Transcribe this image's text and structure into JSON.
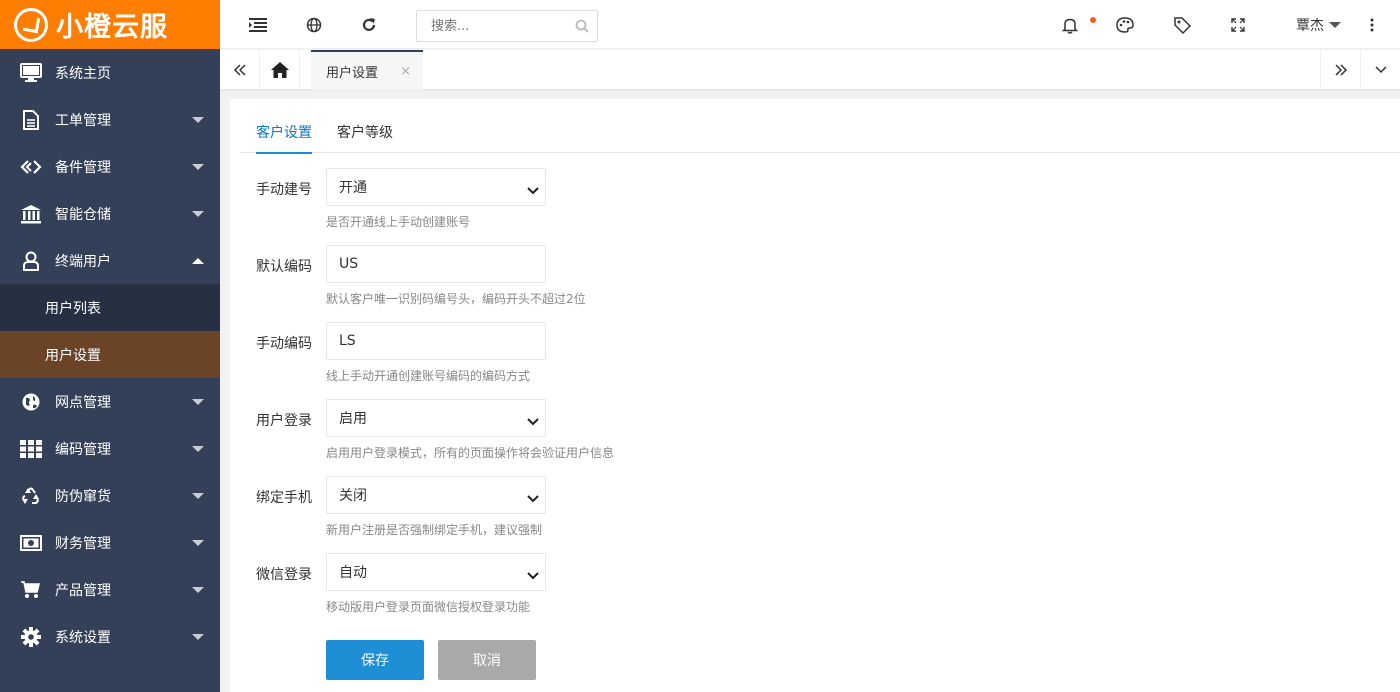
{
  "brand": {
    "name": "小橙云服",
    "color": "#ff7d00"
  },
  "sidebar": {
    "items": [
      {
        "label": "系统主页",
        "icon": "monitor-icon",
        "caret": false
      },
      {
        "label": "工单管理",
        "icon": "document-icon",
        "caret": "down"
      },
      {
        "label": "备件管理",
        "icon": "diamond-link-icon",
        "caret": "down"
      },
      {
        "label": "智能仓储",
        "icon": "bank-icon",
        "caret": "down"
      },
      {
        "label": "终端用户",
        "icon": "user-icon",
        "caret": "up"
      },
      {
        "label": "网点管理",
        "icon": "globe-icon",
        "caret": "down"
      },
      {
        "label": "编码管理",
        "icon": "grid-icon",
        "caret": "down"
      },
      {
        "label": "防伪窜货",
        "icon": "recycle-icon",
        "caret": "down"
      },
      {
        "label": "财务管理",
        "icon": "money-icon",
        "caret": "down"
      },
      {
        "label": "产品管理",
        "icon": "cart-icon",
        "caret": "down"
      },
      {
        "label": "系统设置",
        "icon": "gear-icon",
        "caret": "down"
      }
    ],
    "subitems": [
      {
        "label": "用户列表",
        "active": false
      },
      {
        "label": "用户设置",
        "active": true
      }
    ]
  },
  "topbar": {
    "search_placeholder": "搜索...",
    "username": "覃杰"
  },
  "tabstrip": {
    "tab_label": "用户设置",
    "close": "×"
  },
  "subtabs": [
    {
      "label": "客户设置",
      "active": true
    },
    {
      "label": "客户等级",
      "active": false
    }
  ],
  "form": {
    "rows": [
      {
        "label": "手动建号",
        "value": "开通",
        "type": "select",
        "hint": "是否开通线上手动创建账号"
      },
      {
        "label": "默认编码",
        "value": "US",
        "type": "input",
        "hint": "默认客户唯一识别码编号头，编码开头不超过2位"
      },
      {
        "label": "手动编码",
        "value": "LS",
        "type": "input",
        "hint": "线上手动开通创建账号编码的编码方式"
      },
      {
        "label": "用户登录",
        "value": "启用",
        "type": "select",
        "hint": "启用用户登录模式，所有的页面操作将会验证用户信息"
      },
      {
        "label": "绑定手机",
        "value": "关闭",
        "type": "select",
        "hint": "新用户注册是否强制绑定手机，建议强制"
      },
      {
        "label": "微信登录",
        "value": "自动",
        "type": "select",
        "hint": "移动版用户登录页面微信授权登录功能"
      }
    ],
    "save_label": "保存",
    "cancel_label": "取消"
  },
  "colors": {
    "sidebar_bg": "#344058",
    "sub_bg": "#263042",
    "active_sub_bg": "#6b4428",
    "primary": "#1e8fd4",
    "notify_dot": "#ff5722"
  }
}
